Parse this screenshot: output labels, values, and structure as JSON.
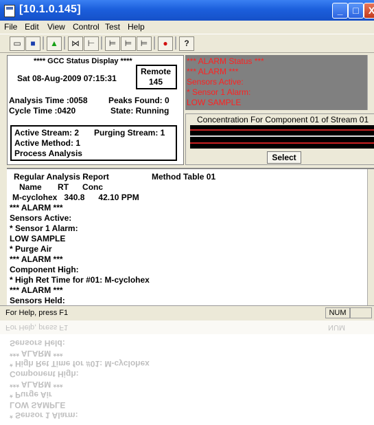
{
  "window": {
    "title": "[10.1.0.145]"
  },
  "menu": [
    "File",
    "Edit",
    "View",
    "Control",
    "Test",
    "Help"
  ],
  "toolbar": {
    "help_glyph": "?"
  },
  "status_display": {
    "heading": "**** GCC Status Display ****",
    "date_time": "Sat 08-Aug-2009 07:15:31",
    "remote_label": "Remote",
    "remote_value": "145",
    "analysis_time": "Analysis Time :0058",
    "peaks_found": "Peaks Found: 0",
    "cycle_time": "Cycle Time   :0420",
    "state": "State: Running",
    "active_stream": "Active Stream: 2",
    "purging_stream": "Purging Stream: 1",
    "active_method": "Active Method: 1",
    "process": "Process Analysis"
  },
  "alarm_status": {
    "lines": [
      "*** ALARM Status ***",
      "*** ALARM ***",
      "Sensors Active:",
      "* Sensor 1 Alarm:",
      "LOW SAMPLE"
    ]
  },
  "concentration": {
    "title": "Concentration For Component 01 of Stream 01",
    "select_label": "Select"
  },
  "report": {
    "title": "Regular Analysis Report",
    "method_table": "Method Table 01",
    "columns": "Name       RT      Conc",
    "row": "M-cyclohex   340.8      42.10 PPM",
    "lines": [
      "*** ALARM ***",
      "Sensors Active:",
      "* Sensor 1 Alarm:",
      "LOW SAMPLE",
      "* Purge Air",
      "*** ALARM ***",
      "Component High:",
      "* High Ret Time for #01: M-cyclohex",
      "*** ALARM ***",
      "Sensors Held:"
    ]
  },
  "statusbar": {
    "help": "For Help, press F1",
    "num": "NUM"
  },
  "reflection": {
    "help": "For Help, press F1",
    "num": "NUM",
    "lines": [
      "Sensors Held:",
      "*** ALARM ***",
      "* High Ret Time for #01: M-cyclohex",
      "Component High:",
      "*** ALARM ***",
      "* Purge Air",
      "LOW SAMPLE",
      "* Sensor 1 Alarm:"
    ]
  },
  "colors": {
    "alarm_red": "#ff2020",
    "titlebar_blue": "#1c5fdc",
    "panel_gray": "#808080"
  }
}
